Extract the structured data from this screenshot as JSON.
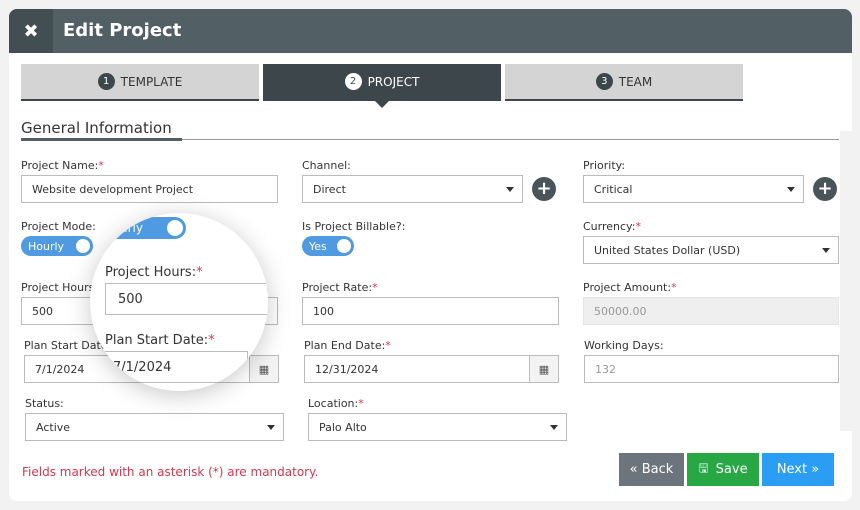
{
  "header": {
    "title": "Edit Project",
    "close_icon": "close-icon"
  },
  "tabs": [
    {
      "num": "1",
      "label": "TEMPLATE",
      "active": false
    },
    {
      "num": "2",
      "label": "PROJECT",
      "active": true
    },
    {
      "num": "3",
      "label": "TEAM",
      "active": false
    }
  ],
  "section": {
    "title": "General Information"
  },
  "fields": {
    "project_name": {
      "label": "Project Name:",
      "required": true,
      "value": "Website development Project"
    },
    "channel": {
      "label": "Channel:",
      "required": false,
      "value": "Direct"
    },
    "priority": {
      "label": "Priority:",
      "required": false,
      "value": "Critical"
    },
    "project_mode": {
      "label": "Project Mode:",
      "required": false,
      "value": "Hourly"
    },
    "billable": {
      "label": "Is Project Billable?:",
      "required": false,
      "value": "Yes"
    },
    "currency": {
      "label": "Currency:",
      "required": true,
      "value": "United States Dollar (USD)"
    },
    "project_hours": {
      "label": "Project Hours:",
      "required": true,
      "value": "500"
    },
    "project_rate": {
      "label": "Project Rate:",
      "required": true,
      "value": "100"
    },
    "project_amount": {
      "label": "Project Amount:",
      "required": true,
      "value": "50000.00"
    },
    "plan_start_date": {
      "label": "Plan Start Date:",
      "required": true,
      "value": "7/1/2024"
    },
    "plan_end_date": {
      "label": "Plan End Date:",
      "required": true,
      "value": "12/31/2024"
    },
    "working_days": {
      "label": "Working Days:",
      "required": false,
      "value": "132"
    },
    "status": {
      "label": "Status:",
      "required": false,
      "value": "Active"
    },
    "location": {
      "label": "Location:",
      "required": true,
      "value": "Palo Alto"
    }
  },
  "required_mark": "*",
  "magnifier": {
    "toggle_text": "urly",
    "hours_label": "Project Hours:",
    "hours_value": "500",
    "start_label": "Plan Start Date:",
    "start_value": "7/1/2024"
  },
  "footer": {
    "mandatory_note": "Fields marked with an asterisk (*) are mandatory.",
    "back_label": "« Back",
    "save_label": "Save",
    "next_label": "Next »"
  },
  "colors": {
    "header": "#525f65",
    "toggle": "#4f9ae0",
    "back": "#6c757d",
    "save": "#28a745",
    "next": "#2a9df4",
    "required": "#e0344a"
  }
}
